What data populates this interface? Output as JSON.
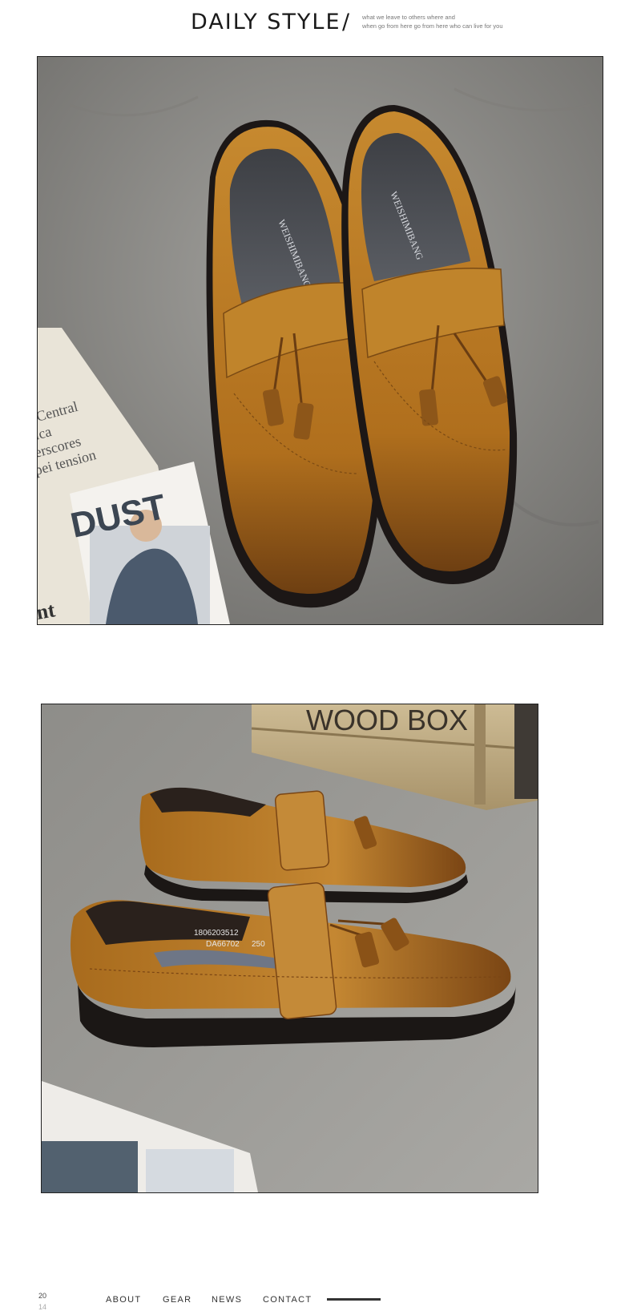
{
  "header": {
    "title": "DAILY STYLE",
    "separator": "/",
    "tagline_line1": "what we leave to others where and",
    "tagline_line2": "when go from here go from here who can live for you"
  },
  "photo1": {
    "insole_brand": "WEISHIMIBANG",
    "magazine_title": "DUST",
    "magazine_text1": "Central",
    "magazine_text2": "ica",
    "magazine_text3": "erscores",
    "magazine_text4": "pei tension",
    "magazine_corner": "nt"
  },
  "meta": {
    "year_top": "20",
    "year_bottom": "14"
  },
  "nav": {
    "items": [
      "ABOUT",
      "GEAR",
      "NEWS",
      "CONTACT"
    ]
  },
  "photo2": {
    "crate_text": "WOOD BOX",
    "label_line1": "1806203512",
    "label_line2": "DA66702",
    "label_size": "250"
  },
  "colors": {
    "leather": "#b5741f",
    "leather_dark": "#7a4a14",
    "concrete": "#8d8c88",
    "sole": "#1e1a18"
  }
}
